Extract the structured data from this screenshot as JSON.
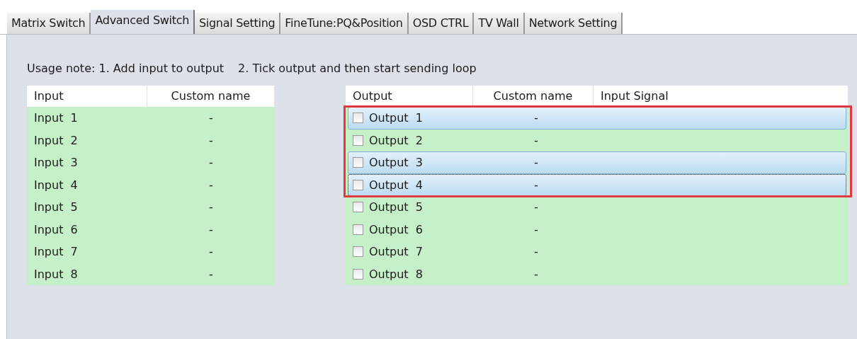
{
  "tabs": [
    {
      "label": "Matrix Switch",
      "selected": false
    },
    {
      "label": "Advanced Switch",
      "selected": true
    },
    {
      "label": "Signal Setting",
      "selected": false
    },
    {
      "label": "FineTune:PQ&Position",
      "selected": false
    },
    {
      "label": "OSD CTRL",
      "selected": false
    },
    {
      "label": "TV Wall",
      "selected": false
    },
    {
      "label": "Network Setting",
      "selected": false
    }
  ],
  "usage_note": {
    "step_1": "Usage note: 1. Add input to output",
    "step_2": "2. Tick output and then start sending loop"
  },
  "input_table": {
    "columns": [
      "Input",
      "Custom name"
    ],
    "rows": [
      {
        "input": "Input  1",
        "custom_name": "-"
      },
      {
        "input": "Input  2",
        "custom_name": "-"
      },
      {
        "input": "Input  3",
        "custom_name": "-"
      },
      {
        "input": "Input  4",
        "custom_name": "-"
      },
      {
        "input": "Input  5",
        "custom_name": "-"
      },
      {
        "input": "Input  6",
        "custom_name": "-"
      },
      {
        "input": "Input  7",
        "custom_name": "-"
      },
      {
        "input": "Input  8",
        "custom_name": "-"
      }
    ]
  },
  "output_table": {
    "columns": [
      "Output",
      "Custom name",
      "Input Signal"
    ],
    "rows": [
      {
        "output": "Output  1",
        "custom_name": "-",
        "checked": false,
        "selected": true,
        "focused": false
      },
      {
        "output": "Output  2",
        "custom_name": "-",
        "checked": false,
        "selected": false,
        "focused": false
      },
      {
        "output": "Output  3",
        "custom_name": "-",
        "checked": false,
        "selected": true,
        "focused": false
      },
      {
        "output": "Output  4",
        "custom_name": "-",
        "checked": false,
        "selected": true,
        "focused": true
      },
      {
        "output": "Output  5",
        "custom_name": "-",
        "checked": false,
        "selected": false,
        "focused": false
      },
      {
        "output": "Output  6",
        "custom_name": "-",
        "checked": false,
        "selected": false,
        "focused": false
      },
      {
        "output": "Output  7",
        "custom_name": "-",
        "checked": false,
        "selected": false,
        "focused": false
      },
      {
        "output": "Output  8",
        "custom_name": "-",
        "checked": false,
        "selected": false,
        "focused": false
      }
    ]
  }
}
